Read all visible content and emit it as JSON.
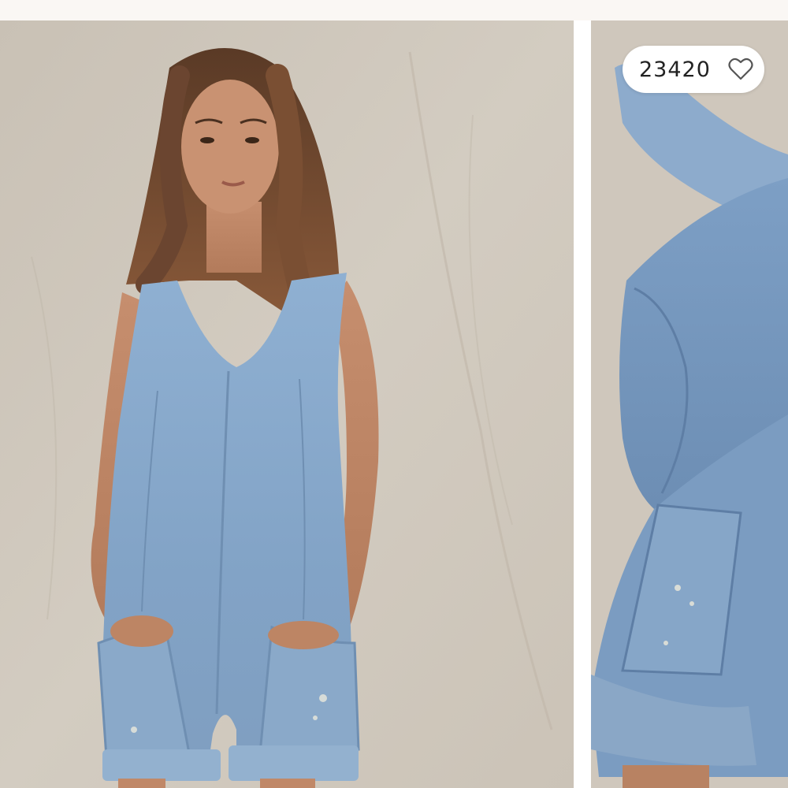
{
  "product_gallery": {
    "like_button": {
      "count": "23420",
      "icon": "heart-outline-icon"
    },
    "images": [
      {
        "icon": "product-photo-model-front"
      },
      {
        "icon": "product-photo-detail-side"
      }
    ]
  },
  "colors": {
    "background": "#faf7f4",
    "backdrop": "#cdc5ba",
    "denim": "#86a6c8",
    "pill": "#ffffff",
    "text": "#222222"
  }
}
